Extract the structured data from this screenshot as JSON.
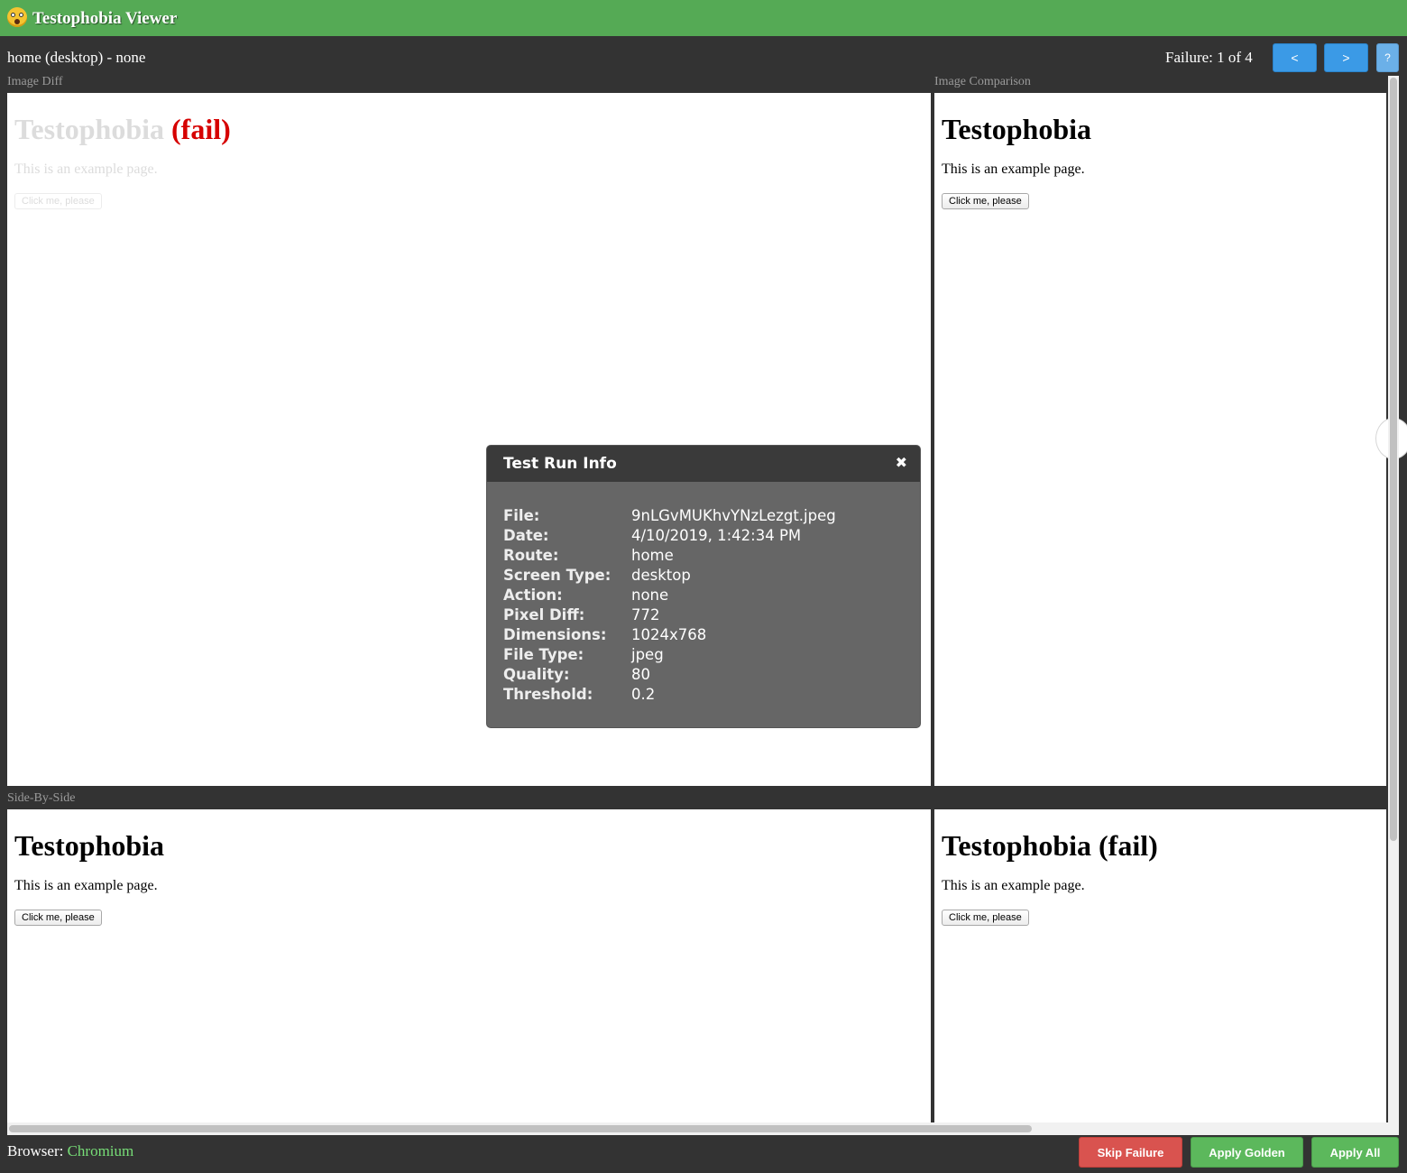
{
  "app": {
    "title": "Testophobia Viewer",
    "logo_icon": "screaming-face-emoji"
  },
  "header": {
    "route_label": "home (desktop) - none",
    "failure_counter": "Failure: 1 of 4",
    "prev_label": "<",
    "next_label": ">",
    "help_label": "?"
  },
  "panels": {
    "image_diff_label": "Image Diff",
    "image_comparison_label": "Image Comparison",
    "side_by_side_label": "Side-By-Side"
  },
  "page_preview": {
    "title": "Testophobia",
    "title_fail_suffix": "(fail)",
    "title_fail_full": "Testophobia (fail)",
    "text": "This is an example page.",
    "button_label": "Click me, please"
  },
  "modal": {
    "title": "Test Run Info",
    "close_icon": "close-icon",
    "rows": [
      {
        "key": "File:",
        "value": "9nLGvMUKhvYNzLezgt.jpeg"
      },
      {
        "key": "Date:",
        "value": "4/10/2019, 1:42:34 PM"
      },
      {
        "key": "Route:",
        "value": "home"
      },
      {
        "key": "Screen Type:",
        "value": "desktop"
      },
      {
        "key": "Action:",
        "value": "none"
      },
      {
        "key": "Pixel Diff:",
        "value": "772"
      },
      {
        "key": "Dimensions:",
        "value": "1024x768"
      },
      {
        "key": "File Type:",
        "value": "jpeg"
      },
      {
        "key": "Quality:",
        "value": "80"
      },
      {
        "key": "Threshold:",
        "value": "0.2"
      }
    ]
  },
  "footer": {
    "browser_prefix": "Browser:",
    "browser_name": "Chromium",
    "skip_label": "Skip Failure",
    "golden_label": "Apply Golden",
    "all_label": "Apply All"
  },
  "colors": {
    "topbar": "#55aa55",
    "background": "#333333",
    "nav_button": "#3b9ae6",
    "skip_button": "#d9534f",
    "apply_button": "#5cb85c",
    "fail_red": "#d60000",
    "browser_name": "#77dd77"
  }
}
